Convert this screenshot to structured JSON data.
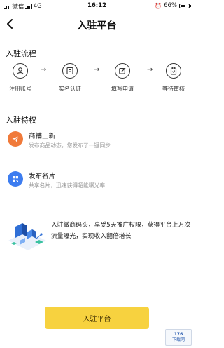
{
  "status_bar": {
    "carrier": "微信",
    "network": "4G",
    "time": "16:12",
    "battery_text": "66%",
    "battery_level": 0.66
  },
  "nav": {
    "title": "入驻平台",
    "back_icon": "chevron-left-icon"
  },
  "flow": {
    "title": "入驻流程",
    "steps": [
      {
        "label": "注册账号",
        "icon": "user-icon"
      },
      {
        "label": "实名认证",
        "icon": "id-card-icon"
      },
      {
        "label": "填写申请",
        "icon": "edit-icon"
      },
      {
        "label": "等待审核",
        "icon": "clipboard-check-icon"
      }
    ],
    "arrow": "→"
  },
  "perks": {
    "title": "入驻特权",
    "items": [
      {
        "title": "商铺上新",
        "desc": "发布商品动态，您发布了一键同步",
        "icon": "paper-plane-icon",
        "color": "#f07a3a"
      },
      {
        "title": "发布名片",
        "desc": "共享名片，迅速获得超能曝光率",
        "icon": "qr-card-icon",
        "color": "#3d7df0"
      }
    ]
  },
  "promo": {
    "text": "入驻微商码头，享受5天推广权限，获得平台上万次流量曝光，实现收入翻倍增长",
    "illustration": "isometric-city-illustration"
  },
  "cta": {
    "label": "入驻平台",
    "color": "#f7d23f"
  },
  "watermark": {
    "line1": "176",
    "line2": "下载网"
  }
}
